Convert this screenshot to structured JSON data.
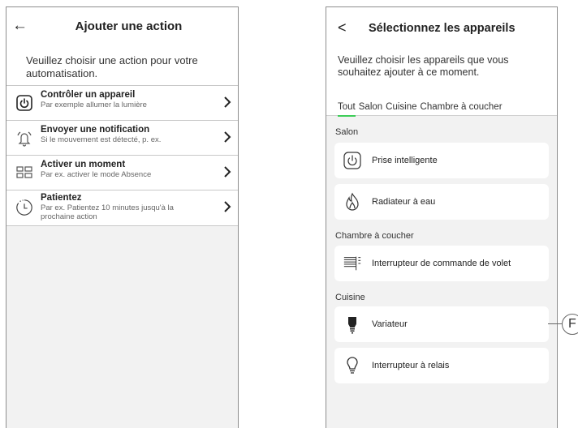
{
  "left": {
    "back_glyph": "←",
    "title": "Ajouter une action",
    "description": "Veuillez choisir une action pour votre automatisation.",
    "actions": [
      {
        "icon": "power-icon",
        "title": "Contrôler un appareil",
        "subtitle": "Par exemple allumer la lumière"
      },
      {
        "icon": "bell-ringing-icon",
        "title": "Envoyer une notification",
        "subtitle": "Si le mouvement est détecté, p. ex."
      },
      {
        "icon": "moment-grid-icon",
        "title": "Activer un moment",
        "subtitle": "Par ex. activer le mode Absence"
      },
      {
        "icon": "timer-icon",
        "title": "Patientez",
        "subtitle": "Par ex. Patientez 10 minutes jusqu'à la prochaine action"
      }
    ],
    "chevron": "›"
  },
  "right": {
    "back_glyph": "<",
    "title": "Sélectionnez les appareils",
    "description": "Veuillez choisir les appareils que vous souhaitez ajouter à ce moment.",
    "tabs": [
      "Tout",
      "Salon",
      "Cuisine",
      "Chambre à coucher"
    ],
    "active_tab": "Tout",
    "accent_color": "#3dcd58",
    "groups": [
      {
        "name": "Salon",
        "devices": [
          {
            "icon": "power-icon",
            "label": "Prise intelligente"
          },
          {
            "icon": "flame-icon",
            "label": "Radiateur à eau"
          }
        ]
      },
      {
        "name": "Chambre à coucher",
        "devices": [
          {
            "icon": "shutter-switch-icon",
            "label": "Interrupteur de commande de volet"
          }
        ]
      },
      {
        "name": "Cuisine",
        "devices": [
          {
            "icon": "bulb-filled-icon",
            "label": "Variateur"
          },
          {
            "icon": "bulb-outline-icon",
            "label": "Interrupteur à relais"
          }
        ]
      }
    ]
  },
  "callout": {
    "letter": "F"
  }
}
